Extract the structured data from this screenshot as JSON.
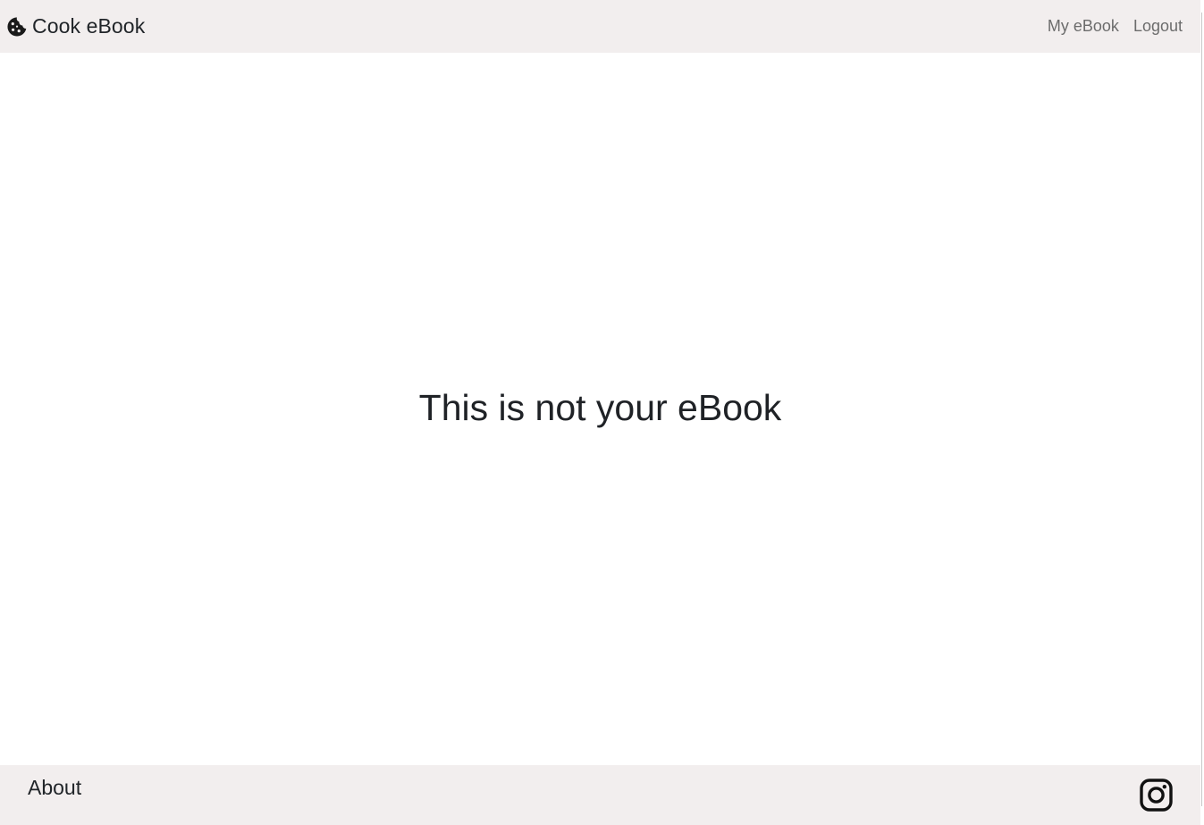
{
  "navbar": {
    "brand_icon": "cookie-icon",
    "brand_label": "Cook eBook",
    "links": [
      {
        "label": "My eBook"
      },
      {
        "label": "Logout"
      }
    ]
  },
  "main": {
    "message": "This is not your eBook"
  },
  "footer": {
    "about_label": "About",
    "social_icon": "instagram-icon"
  },
  "colors": {
    "bar_background": "#f2eeee",
    "text": "#212529",
    "nav_link": "#6c6c6c"
  }
}
